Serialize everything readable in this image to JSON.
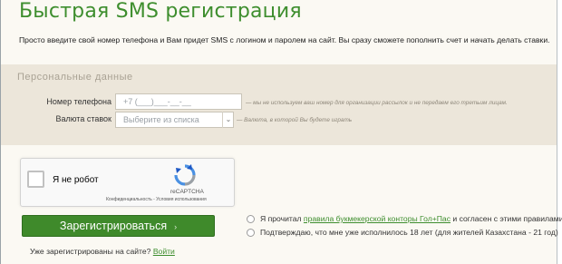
{
  "page": {
    "title": "Быстрая SMS регистрация",
    "intro": "Просто введите свой номер телефона и Вам придет SMS с логином и паролем на сайт. Вы сразу сможете пополнить счет и начать делать ставки."
  },
  "personal": {
    "section_title": "Персональные данные",
    "phone_label": "Номер телефона",
    "phone_placeholder": "+7 (___)___-__-__",
    "phone_hint": "— мы не используем ваш номер для организации рассылок и не передаем его третьим лицам.",
    "currency_label": "Валюта ставок",
    "currency_placeholder": "Выберите из списка",
    "currency_arrow": "⌄",
    "currency_hint": "— Валюта, в которой Вы будете играть"
  },
  "captcha": {
    "label": "Я не робот",
    "brand": "reCAPTCHA",
    "links": "Конфиденциальность - Условия использования"
  },
  "register": {
    "button_label": "Зарегистрироваться",
    "chevron": "›"
  },
  "login": {
    "prompt": "Уже зарегистрированы на сайте?",
    "link_label": "Войти"
  },
  "agreements": {
    "rules_prefix": "Я прочитал",
    "rules_link": "правила букмекерской конторы Гол+Пас",
    "rules_suffix": "и согласен с этими правилами",
    "age_text": "Подтверждаю, что мне уже исполнилось 18 лет (для жителей Казахстана - 21 год)"
  },
  "colors": {
    "brand_green": "#3e8e2e",
    "button_green": "#3f8a2b",
    "personal_bg": "#ece6da",
    "page_bg": "#fbf9f3"
  }
}
